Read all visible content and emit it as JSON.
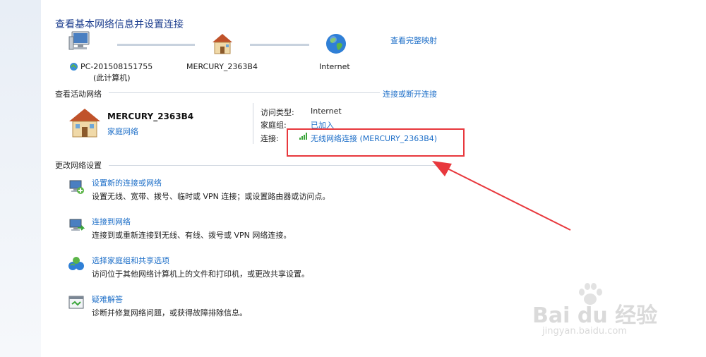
{
  "header": {
    "title": "查看基本网络信息并设置连接",
    "map_link": "查看完整映射"
  },
  "map": {
    "pc_name": "PC-201508151755",
    "pc_sub": "(此计算机)",
    "router_name": "MERCURY_2363B4",
    "internet_name": "Internet"
  },
  "active_networks": {
    "heading": "查看活动网络",
    "connect_link": "连接或断开连接",
    "network_name": "MERCURY_2363B4",
    "network_type": "家庭网络",
    "access_type_label": "访问类型:",
    "access_type_value": "Internet",
    "homegroup_label": "家庭组:",
    "homegroup_value": "已加入",
    "connection_label": "连接:",
    "connection_value": "无线网络连接 (MERCURY_2363B4)"
  },
  "change_settings": {
    "heading": "更改网络设置",
    "tasks": [
      {
        "title": "设置新的连接或网络",
        "desc": "设置无线、宽带、拨号、临时或 VPN 连接；或设置路由器或访问点。",
        "icon": "setup-connection-icon"
      },
      {
        "title": "连接到网络",
        "desc": "连接到或重新连接到无线、有线、拨号或 VPN 网络连接。",
        "icon": "connect-network-icon"
      },
      {
        "title": "选择家庭组和共享选项",
        "desc": "访问位于其他网络计算机上的文件和打印机，或更改共享设置。",
        "icon": "homegroup-icon"
      },
      {
        "title": "疑难解答",
        "desc": "诊断并修复网络问题，或获得故障排除信息。",
        "icon": "troubleshoot-icon"
      }
    ]
  },
  "watermark": {
    "brand": "Bai du 经验",
    "url": "jingyan.baidu.com"
  },
  "colors": {
    "link": "#1e6fc8",
    "title": "#1e3f8f",
    "highlight": "#e8383d"
  }
}
